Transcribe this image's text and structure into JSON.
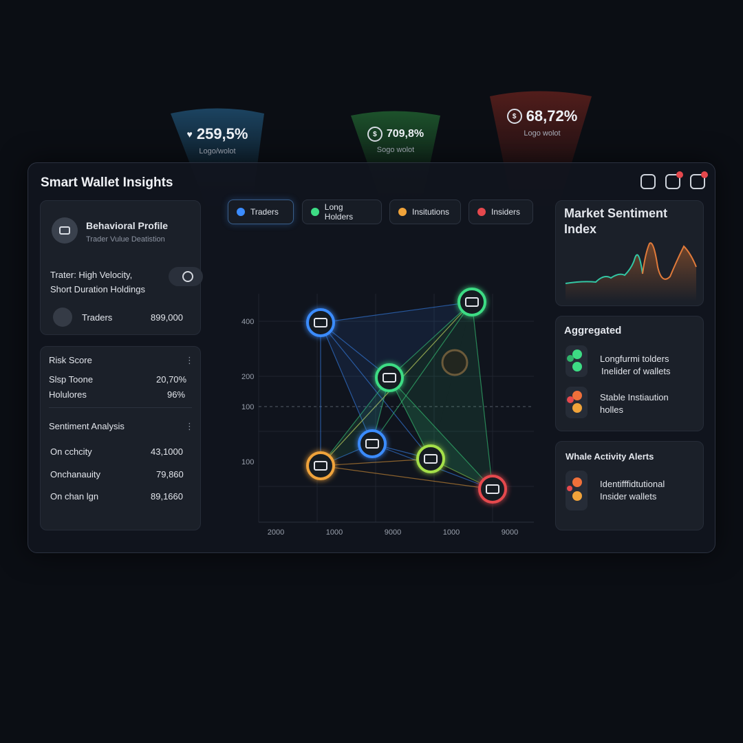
{
  "callouts": [
    {
      "value": "259,5%",
      "sub": "Logo/wolot",
      "icon": "heart-icon"
    },
    {
      "value": "709,8%",
      "sub": "Sogo wolot",
      "icon": "coin-icon"
    },
    {
      "value": "68,72%",
      "sub": "Logo wolot",
      "icon": "coin-icon"
    }
  ],
  "header": {
    "title": "Smart Wallet Insights"
  },
  "behavior": {
    "title": "Behavioral Profile",
    "subtitle": "Trader Vulue Deatistion",
    "desc_line1": "Trater: High Velocity,",
    "desc_line2": "Short Duration Holdings",
    "row_label": "Traders",
    "row_value": "899,000"
  },
  "risk": {
    "title": "Risk Score",
    "rows": [
      {
        "label": "Slsp Toone",
        "value": "20,70%"
      },
      {
        "label": "Holulores",
        "value": "96%"
      }
    ]
  },
  "sentiment": {
    "title": "Sentiment Analysis",
    "rows": [
      {
        "label": "On cchcity",
        "value": "43,1000"
      },
      {
        "label": "Onchanauity",
        "value": "79,860"
      },
      {
        "label": "On chan lgn",
        "value": "89,1660"
      }
    ]
  },
  "filters": [
    {
      "label": "Traders",
      "color": "#3b8cff"
    },
    {
      "label": "Long Holders",
      "color": "#3ddc84"
    },
    {
      "label": "Insitutions",
      "color": "#f0a33a"
    },
    {
      "label": "Insiders",
      "color": "#e5484d"
    }
  ],
  "chart_data": {
    "type": "scatter",
    "y_ticks": [
      "400",
      "200",
      "100",
      "100"
    ],
    "x_ticks": [
      "2000",
      "1000",
      "9000",
      "1000",
      "9000"
    ],
    "nodes": [
      {
        "group": "Traders",
        "color": "#3b8cff"
      },
      {
        "group": "Long Holders",
        "color": "#3ddc84"
      },
      {
        "group": "Long Holders",
        "color": "#3ddc84"
      },
      {
        "group": "Traders",
        "color": "#3b8cff"
      },
      {
        "group": "Insitutions",
        "color": "#f0a33a"
      },
      {
        "group": "Long Holders",
        "color": "#a4e04a"
      },
      {
        "group": "Insiders",
        "color": "#e5484d"
      }
    ]
  },
  "market": {
    "title_line1": "Market Sentiment",
    "title_line2": "Index"
  },
  "aggregated": {
    "title": "Aggregated",
    "item1_line1": "Longfurmi tolders",
    "item1_line2": "Inelider of wallets",
    "item2_line1": "Stable Instiaution",
    "item2_line2": "holles"
  },
  "whale": {
    "title": "Whale Activity Alerts",
    "line1": "Identifffidtutional",
    "line2": "Insider wallets"
  },
  "colors": {
    "blue": "#3b8cff",
    "green": "#3ddc84",
    "orange": "#f0a33a",
    "red": "#e5484d"
  }
}
